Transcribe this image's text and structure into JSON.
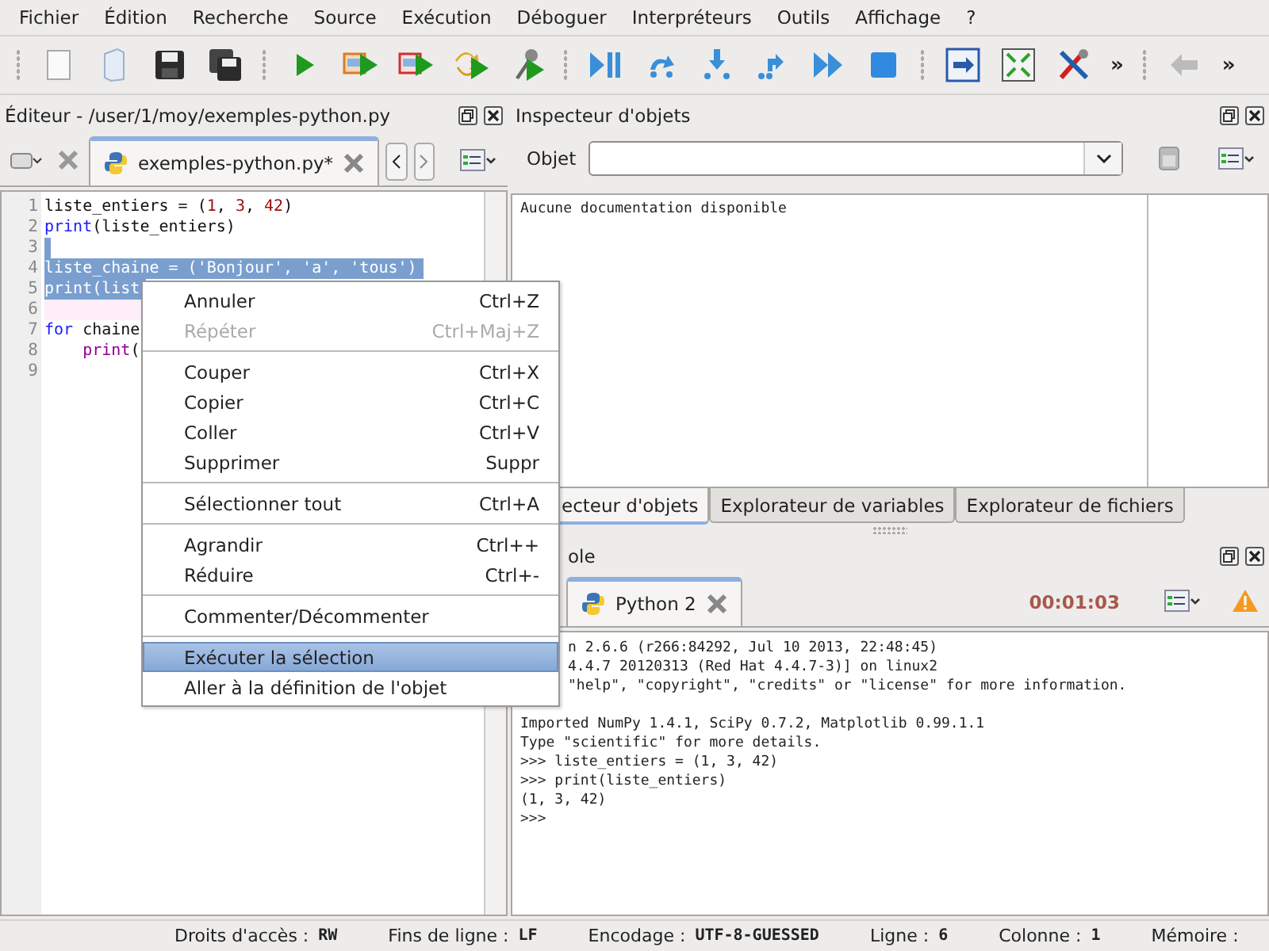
{
  "menu_bar": [
    "Fichier",
    "Édition",
    "Recherche",
    "Source",
    "Exécution",
    "Déboguer",
    "Interpréteurs",
    "Outils",
    "Affichage",
    "?"
  ],
  "toolbar": {
    "overflow": [
      "»",
      "»"
    ]
  },
  "editor": {
    "title": "Éditeur - /user/1/moy/exemples-python.py",
    "tabs": [
      {
        "label": "exemples-python.py*",
        "selected": true
      }
    ],
    "lines": [
      {
        "number": "1",
        "selected": false,
        "current": false,
        "tokens": [
          {
            "text": "liste_entiers = (",
            "kind": "plain"
          },
          {
            "text": "1",
            "kind": "number"
          },
          {
            "text": ", ",
            "kind": "plain"
          },
          {
            "text": "3",
            "kind": "number"
          },
          {
            "text": ", ",
            "kind": "plain"
          },
          {
            "text": "42",
            "kind": "number"
          },
          {
            "text": ")",
            "kind": "plain"
          }
        ]
      },
      {
        "number": "2",
        "selected": false,
        "current": false,
        "tokens": [
          {
            "text": "print",
            "kind": "keyword"
          },
          {
            "text": "(liste_entiers)",
            "kind": "plain"
          }
        ]
      },
      {
        "number": "3",
        "selected": true,
        "current": false
      },
      {
        "number": "4",
        "selected": true,
        "current": false,
        "tokens": [
          {
            "text": "liste_chaine = ('Bonjour', 'a', 'tous')",
            "kind": "plain"
          }
        ]
      },
      {
        "number": "5",
        "selected": true,
        "current": false,
        "tokens": [
          {
            "text": "print(list",
            "kind": "plain"
          }
        ]
      },
      {
        "number": "6",
        "selected": false,
        "current": true
      },
      {
        "number": "7",
        "selected": false,
        "current": false,
        "tokens": [
          {
            "text": "for",
            "kind": "keyword"
          },
          {
            "text": " chaine",
            "kind": "plain"
          }
        ]
      },
      {
        "number": "8",
        "selected": false,
        "current": false,
        "tokens": [
          {
            "text": "    print",
            "kind": "builtin"
          },
          {
            "text": "(",
            "kind": "plain"
          }
        ]
      },
      {
        "number": "9",
        "selected": false,
        "current": false
      }
    ]
  },
  "context_menu": {
    "items": [
      {
        "kind": "item",
        "label": "Annuler",
        "shortcut": "Ctrl+Z",
        "disabled": false,
        "selected": false
      },
      {
        "kind": "item",
        "label": "Répéter",
        "shortcut": "Ctrl+Maj+Z",
        "disabled": true,
        "selected": false
      },
      {
        "kind": "separator"
      },
      {
        "kind": "item",
        "label": "Couper",
        "shortcut": "Ctrl+X",
        "disabled": false,
        "selected": false
      },
      {
        "kind": "item",
        "label": "Copier",
        "shortcut": "Ctrl+C",
        "disabled": false,
        "selected": false
      },
      {
        "kind": "item",
        "label": "Coller",
        "shortcut": "Ctrl+V",
        "disabled": false,
        "selected": false
      },
      {
        "kind": "item",
        "label": "Supprimer",
        "shortcut": "Suppr",
        "disabled": false,
        "selected": false
      },
      {
        "kind": "separator"
      },
      {
        "kind": "item",
        "label": "Sélectionner tout",
        "shortcut": "Ctrl+A",
        "disabled": false,
        "selected": false
      },
      {
        "kind": "separator"
      },
      {
        "kind": "item",
        "label": "Agrandir",
        "shortcut": "Ctrl++",
        "disabled": false,
        "selected": false
      },
      {
        "kind": "item",
        "label": "Réduire",
        "shortcut": "Ctrl+-",
        "disabled": false,
        "selected": false
      },
      {
        "kind": "separator"
      },
      {
        "kind": "item",
        "label": "Commenter/Décommenter",
        "disabled": false,
        "selected": false
      },
      {
        "kind": "separator"
      },
      {
        "kind": "item",
        "label": "Exécuter la sélection",
        "disabled": false,
        "selected": true
      },
      {
        "kind": "item",
        "label": "Aller à la définition de l'objet",
        "disabled": false,
        "selected": false
      }
    ]
  },
  "object_inspector": {
    "title": "Inspecteur d'objets",
    "object_label": "Objet",
    "doc_text": "Aucune documentation disponible"
  },
  "dock_tabs": [
    {
      "label": "ecteur d'objets",
      "selected": true
    },
    {
      "label": "Explorateur de variables",
      "selected": false
    },
    {
      "label": "Explorateur de fichiers",
      "selected": false
    }
  ],
  "console": {
    "title": "ole",
    "tabs": [
      {
        "label": "Python 2",
        "selected": true
      }
    ],
    "elapsed": "00:01:03",
    "paragraphs": [
      [
        {
          "text": "n 2.6.6 (r266:84292, Jul 10 2013, 22:48:45)",
          "covered": true
        },
        {
          "text": "4.4.7 20120313 (Red Hat 4.4.7-3)] on linux2",
          "covered": true
        },
        {
          "text": "\"help\", \"copyright\", \"credits\" or \"license\" for more information.",
          "covered": true
        }
      ],
      [
        {
          "text": "Imported NumPy 1.4.1, SciPy 0.7.2, Matplotlib 0.99.1.1",
          "covered": false
        },
        {
          "text": "Type \"scientific\" for more details.",
          "covered": false
        },
        {
          "text": ">>> liste_entiers = (1, 3, 42)",
          "covered": false
        },
        {
          "text": ">>> print(liste_entiers)",
          "covered": false
        },
        {
          "text": "(1, 3, 42)",
          "covered": false
        },
        {
          "text": ">>>",
          "covered": false
        }
      ]
    ]
  },
  "status_bar": [
    {
      "label": "Droits d'accès :",
      "value": "RW"
    },
    {
      "label": "Fins de ligne :",
      "value": "LF"
    },
    {
      "label": "Encodage :",
      "value": "UTF-8-GUESSED"
    },
    {
      "label": "Ligne :",
      "value": "6"
    },
    {
      "label": "Colonne :",
      "value": "1"
    },
    {
      "label": "Mémoire :"
    }
  ]
}
